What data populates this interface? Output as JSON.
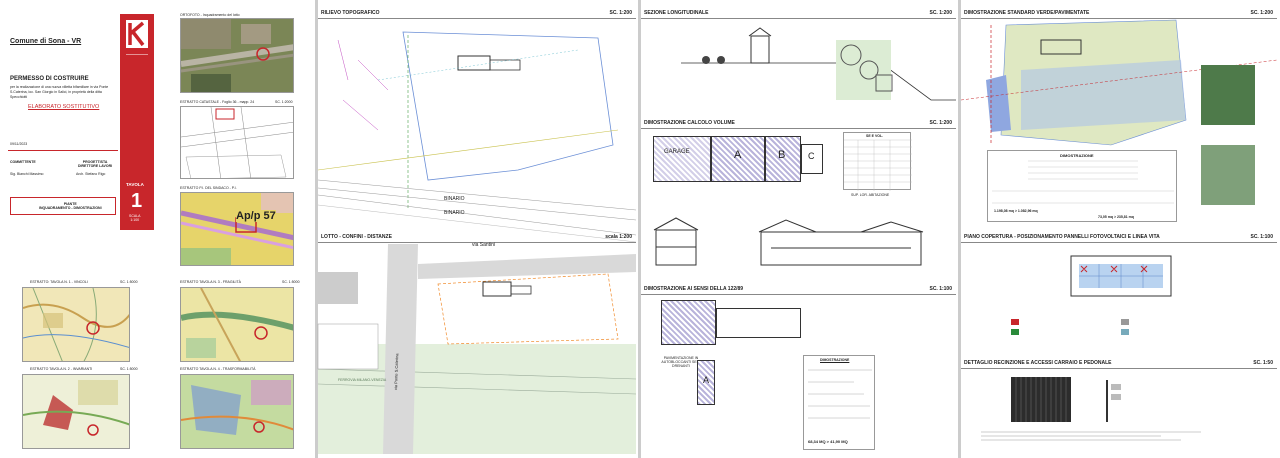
{
  "title_block": {
    "municipality": "Comune di Sona - VR",
    "permit": "PERMESSO DI COSTRUIRE",
    "description_lines": [
      "per la realizzazione di una nuova villetta bifamiliare in via Ponte",
      "S.Caterina, loc. San Giorgio in Salici, in proprietà della ditta",
      "Specchiotti"
    ],
    "subtitle": "ELABORATO SOSTITUTIVO",
    "date": "09/11/2023",
    "committente_label": "COMMITTENTE",
    "committente_name": "Sig. Bianchi Massimo",
    "progettista_label": "PROGETTISTA\nDIRETTORE LAVORI",
    "progettista_name": "Arch. Stefano Rigo",
    "tavola_label": "TAVOLA",
    "tavola_number": "1",
    "tavola_subject": "PIANTE\nINQUADRAMENTO - DIMOSTRAZIONI",
    "scala_label": "SCALA\n1:100",
    "logo_letter": "K"
  },
  "accent": "#c8262b",
  "left_maps": [
    {
      "label": "ESTRATTO: TAVOLA N. 1 - VINCOLI",
      "scale": "SC. 1:5000"
    },
    {
      "label": "ESTRATTO TAVOLA N. 2 - INVARIANTI",
      "scale": "SC. 1:5000"
    }
  ],
  "mid_maps": [
    {
      "label": "ORTOFOTO - Inquadramento del lotto",
      "scale": ""
    },
    {
      "label": "ESTRATTO CATASTALE - Foglio 36 - mapp. 24",
      "scale": "SC. 1:2000"
    },
    {
      "label": "ESTRATTO P.I. DEL SINDACO - P.I.",
      "scale": "SC. 1:2000"
    },
    {
      "label": "ESTRATTO TAVOLA N. 3 - FRAGILITÀ",
      "scale": "SC. 1:5000"
    },
    {
      "label": "ESTRATTO TAVOLA N. 4 - TRASFORMABILITÀ",
      "scale": "SC. 1:5000"
    }
  ],
  "zone_label": "Ap/p 57",
  "rilievo": {
    "title": "RILIEVO TOPOGRAFICO",
    "scale": "SC. 1:200",
    "binario1": "BINARIO",
    "binario2": "BINARIO"
  },
  "lotto": {
    "title": "LOTTO - CONFINI - DISTANZE",
    "scale": "scala 1:200",
    "street": "via Santini",
    "road": "via Ponte S.Caterina",
    "ferrovia": "FERROVIA MILANO-VENEZIA"
  },
  "sezione": {
    "title": "SEZIONE LONGITUDINALE",
    "scale": "SC. 1:200"
  },
  "volume": {
    "title": "DIMOSTRAZIONE CALCOLO VOLUME",
    "scale": "SC. 1:200",
    "blocks": [
      "GARAGE",
      "A",
      "B",
      "C"
    ],
    "table_title": "SE E VOL.",
    "total": "SUP. LOR. ABITAZIONE"
  },
  "legge": {
    "title": "DIMOSTRAZIONE AI SENSI DELLA 122/89",
    "scale": "SC. 1:100",
    "pav_label": "PAVIMENTAZIONE IN AUTOBLOCCANTI SEMI DRENANTI",
    "block": "A",
    "table_title": "DIMOSTRAZIONE",
    "result": "68,34 MQ > 41,90 MQ"
  },
  "verde": {
    "title": "DIMOSTRAZIONE STANDARD VERDE/PAVIMENTATE",
    "scale": "SC. 1:200",
    "table_title": "DIMOSTRAZIONE",
    "results": [
      "1.198,08 mq > 1.082,96 mq",
      "73,05 mq > 235,81 mq"
    ]
  },
  "copertura": {
    "title": "PIANO COPERTURA - POSIZIONAMENTO PANNELLI FOTOVOLTAICI E LINEA VITA",
    "scale": "SC. 1:100"
  },
  "recinzione": {
    "title": "DETTAGLIO RECINZIONE E ACCESSI CARRAIO E PEDONALE",
    "scale": "SC. 1:50"
  }
}
